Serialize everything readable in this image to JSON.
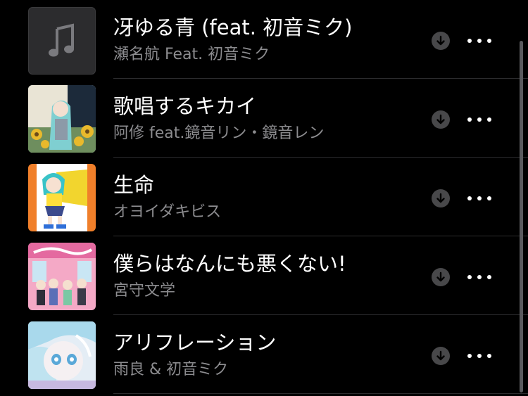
{
  "songs": [
    {
      "title": "冴ゆる青 (feat. 初音ミク)",
      "artist": "瀬名航 Feat. 初音ミク",
      "artwork": "music-note-placeholder"
    },
    {
      "title": "歌唱するキカイ",
      "artist": "阿修 feat.鏡音リン・鏡音レン",
      "artwork": "album-cover-sunflowers"
    },
    {
      "title": "生命",
      "artist": "オヨイダキビス",
      "artwork": "album-cover-orange"
    },
    {
      "title": "僕らはなんにも悪くない!",
      "artist": "宮守文学",
      "artwork": "album-cover-show-window"
    },
    {
      "title": "アリフレーション",
      "artist": "雨良 & 初音ミク",
      "artwork": "album-cover-pale-blue"
    }
  ],
  "icons": {
    "download": "download-arrow-icon",
    "more": "more-ellipsis-icon"
  },
  "colors": {
    "background": "#000000",
    "title": "#ffffff",
    "subtitle": "#8c8c8f",
    "button_bg": "#48484a"
  }
}
